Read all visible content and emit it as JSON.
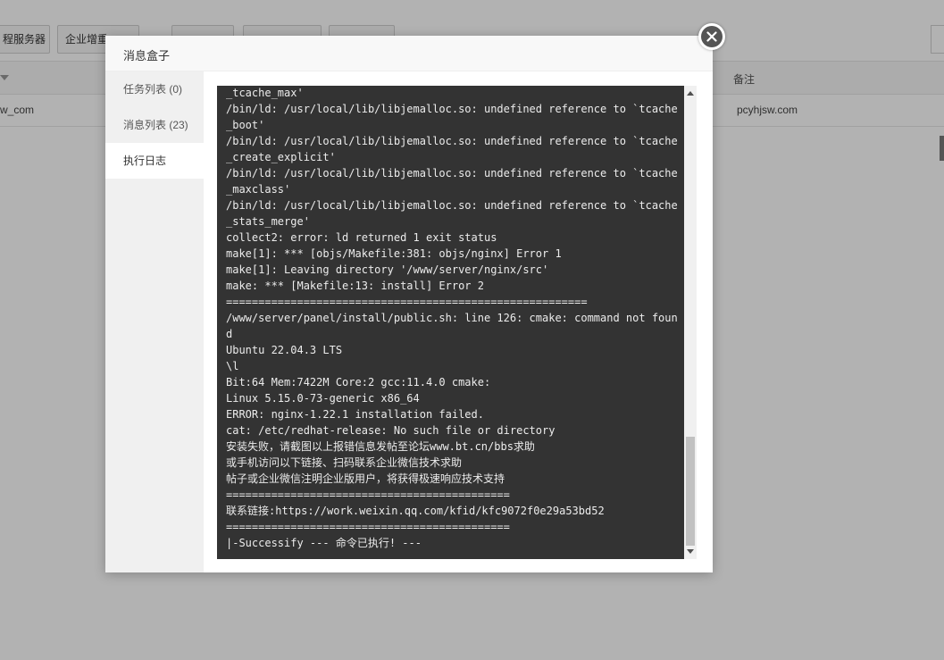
{
  "background": {
    "toolbar_buttons": [
      {
        "label": "程服务器"
      },
      {
        "label": "企业增重"
      },
      {
        "label": ""
      },
      {
        "label": ""
      },
      {
        "label": ""
      }
    ],
    "table": {
      "remark_header": "备注",
      "row_name": "w_com",
      "row_remark": "pcyhjsw.com"
    }
  },
  "modal": {
    "title": "消息盒子",
    "close_icon": "close-icon",
    "sidebar": {
      "items": [
        {
          "label": "任务列表 (0)",
          "active": false
        },
        {
          "label": "消息列表 (23)",
          "active": false
        },
        {
          "label": "执行日志",
          "active": true
        }
      ]
    },
    "console": {
      "lines": [
        "_tcache_max'",
        "/bin/ld: /usr/local/lib/libjemalloc.so: undefined reference to `tcache",
        "_boot'",
        "/bin/ld: /usr/local/lib/libjemalloc.so: undefined reference to `tcache",
        "_create_explicit'",
        "/bin/ld: /usr/local/lib/libjemalloc.so: undefined reference to `tcache",
        "_maxclass'",
        "/bin/ld: /usr/local/lib/libjemalloc.so: undefined reference to `tcache",
        "_stats_merge'",
        "collect2: error: ld returned 1 exit status",
        "make[1]: *** [objs/Makefile:381: objs/nginx] Error 1",
        "make[1]: Leaving directory '/www/server/nginx/src'",
        "make: *** [Makefile:13: install] Error 2",
        "========================================================",
        "/www/server/panel/install/public.sh: line 126: cmake: command not foun",
        "d",
        "Ubuntu 22.04.3 LTS",
        "\\l",
        "Bit:64 Mem:7422M Core:2 gcc:11.4.0 cmake:",
        "Linux 5.15.0-73-generic x86_64",
        "ERROR: nginx-1.22.1 installation failed.",
        "cat: /etc/redhat-release: No such file or directory",
        "安装失败，请截图以上报错信息发帖至论坛www.bt.cn/bbs求助",
        "或手机访问以下链接、扫码联系企业微信技术求助",
        "帖子或企业微信注明企业版用户，将获得极速响应技术支持",
        "============================================",
        "联系链接:https://work.weixin.qq.com/kfid/kfc9072f0e29a53bd52",
        "============================================",
        "|-Successify --- 命令已执行! ---"
      ],
      "scroll_position": 0.74
    }
  }
}
